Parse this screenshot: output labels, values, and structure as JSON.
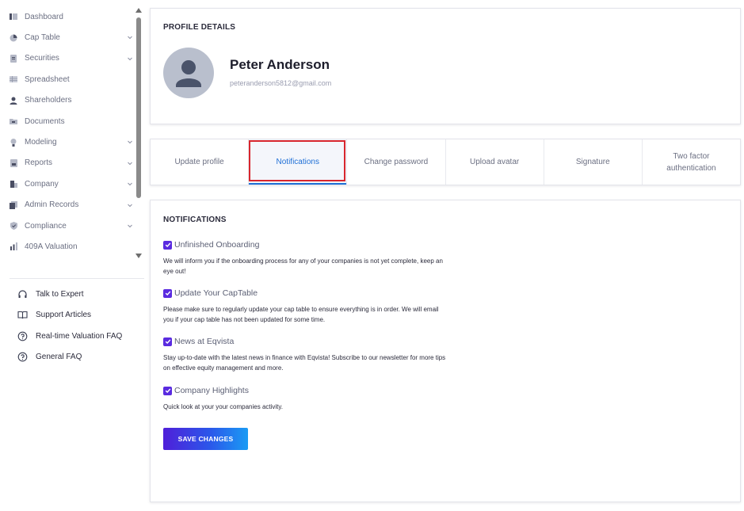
{
  "sidebar": {
    "items": [
      {
        "label": "Dashboard",
        "icon": "dashboard-icon",
        "expandable": false
      },
      {
        "label": "Cap Table",
        "icon": "pie-chart-icon",
        "expandable": true
      },
      {
        "label": "Securities",
        "icon": "document-icon",
        "expandable": true
      },
      {
        "label": "Spreadsheet",
        "icon": "spreadsheet-icon",
        "expandable": false
      },
      {
        "label": "Shareholders",
        "icon": "user-icon",
        "expandable": false
      },
      {
        "label": "Documents",
        "icon": "folder-icon",
        "expandable": false
      },
      {
        "label": "Modeling",
        "icon": "lightbulb-icon",
        "expandable": true
      },
      {
        "label": "Reports",
        "icon": "report-icon",
        "expandable": true
      },
      {
        "label": "Company",
        "icon": "building-icon",
        "expandable": true
      },
      {
        "label": "Admin Records",
        "icon": "records-icon",
        "expandable": true
      },
      {
        "label": "Compliance",
        "icon": "shield-icon",
        "expandable": true
      },
      {
        "label": "409A Valuation",
        "icon": "valuation-icon",
        "expandable": false
      }
    ],
    "help": [
      {
        "label": "Talk to Expert",
        "icon": "headset-icon"
      },
      {
        "label": "Support Articles",
        "icon": "book-icon"
      },
      {
        "label": "Real-time Valuation FAQ",
        "icon": "help-circle-icon"
      },
      {
        "label": "General FAQ",
        "icon": "help-circle-icon"
      }
    ]
  },
  "profile": {
    "section_title": "PROFILE DETAILS",
    "name": "Peter Anderson",
    "email": "peteranderson5812@gmail.com"
  },
  "tabs": [
    {
      "label": "Update profile",
      "active": false
    },
    {
      "label": "Notifications",
      "active": true
    },
    {
      "label": "Change password",
      "active": false
    },
    {
      "label": "Upload avatar",
      "active": false
    },
    {
      "label": "Signature",
      "active": false
    },
    {
      "label": "Two factor authentication",
      "active": false
    }
  ],
  "notifications": {
    "section_title": "NOTIFICATIONS",
    "items": [
      {
        "label": "Unfinished Onboarding",
        "checked": true,
        "description": "We will inform you if the onboarding process for any of your companies is not yet complete, keep an eye out!"
      },
      {
        "label": "Update Your CapTable",
        "checked": true,
        "description": "Please make sure to regularly update your cap table to ensure everything is in order. We will email you if your cap table has not been updated for some time."
      },
      {
        "label": "News at Eqvista",
        "checked": true,
        "description": "Stay up-to-date with the latest news in finance with Eqvista! Subscribe to our newsletter for more tips on effective equity management and more."
      },
      {
        "label": "Company Highlights",
        "checked": true,
        "description": "Quick look at your your companies activity."
      }
    ],
    "save_label": "SAVE CHANGES"
  },
  "colors": {
    "accent": "#1f6fd6",
    "checkbox": "#5a2be0",
    "highlight_box": "#d8262e",
    "button_gradient": [
      "#4f1fd9",
      "#1a9bf4"
    ]
  }
}
